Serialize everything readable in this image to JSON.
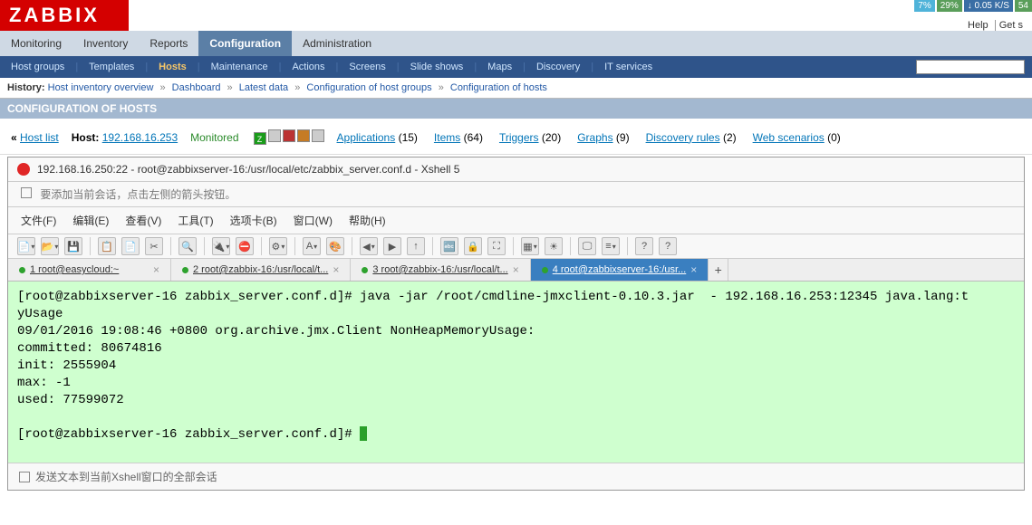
{
  "logo": "ZABBIX",
  "topstats": {
    "p1": "7%",
    "p2": "29%",
    "rate": "0.05 K/S",
    "extra": "54"
  },
  "toplinks": {
    "help": "Help",
    "get": "Get s"
  },
  "tabs1": [
    "Monitoring",
    "Inventory",
    "Reports",
    "Configuration",
    "Administration"
  ],
  "tabs1_active": 3,
  "tabs2": [
    "Host groups",
    "Templates",
    "Hosts",
    "Maintenance",
    "Actions",
    "Screens",
    "Slide shows",
    "Maps",
    "Discovery",
    "IT services"
  ],
  "tabs2_active": 2,
  "history": {
    "label": "History:",
    "items": [
      "Host inventory overview",
      "Dashboard",
      "Latest data",
      "Configuration of host groups",
      "Configuration of hosts"
    ]
  },
  "confbar": "CONFIGURATION OF HOSTS",
  "hostbar": {
    "back": "« ",
    "hostlist": "Host list",
    "hostlabel": "Host:",
    "hostip": "192.168.16.253",
    "monitored": "Monitored",
    "links": [
      {
        "label": "Applications",
        "count": "(15)"
      },
      {
        "label": "Items",
        "count": "(64)"
      },
      {
        "label": "Triggers",
        "count": "(20)"
      },
      {
        "label": "Graphs",
        "count": "(9)"
      },
      {
        "label": "Discovery rules",
        "count": "(2)"
      },
      {
        "label": "Web scenarios",
        "count": "(0)"
      }
    ]
  },
  "xshell": {
    "title": "192.168.16.250:22 - root@zabbixserver-16:/usr/local/etc/zabbix_server.conf.d - Xshell 5",
    "hint": "要添加当前会话，点击左侧的箭头按钮。",
    "menu": [
      "文件(F)",
      "编辑(E)",
      "查看(V)",
      "工具(T)",
      "选项卡(B)",
      "窗口(W)",
      "帮助(H)"
    ],
    "tabs": [
      "1 root@easycloud:~",
      "2 root@zabbix-16:/usr/local/t...",
      "3 root@zabbix-16:/usr/local/t...",
      "4 root@zabbixserver-16:/usr..."
    ],
    "tabs_active": 3,
    "terminal": "[root@zabbixserver-16 zabbix_server.conf.d]# java -jar /root/cmdline-jmxclient-0.10.3.jar  - 192.168.16.253:12345 java.lang:t\nyUsage\n09/01/2016 19:08:46 +0800 org.archive.jmx.Client NonHeapMemoryUsage:\ncommitted: 80674816\ninit: 2555904\nmax: -1\nused: 77599072\n\n[root@zabbixserver-16 zabbix_server.conf.d]# ",
    "bottom": "发送文本到当前Xshell窗口的全部会话"
  },
  "icons": {
    "new": "📄",
    "open": "📂",
    "save": "💾",
    "copy": "📋",
    "paste": "📄",
    "cut": "✂",
    "find": "🔍",
    "reconnect": "🔌",
    "disconnect": "⛔",
    "props": "⚙",
    "font": "A",
    "color": "🎨",
    "back": "◀",
    "fwd": "▶",
    "up": "↑",
    "encode": "🔤",
    "lock": "🔒",
    "fullscreen": "⛶",
    "layout": "▦",
    "trans": "☀",
    "screen": "🖵",
    "opt": "≡",
    "help": "?"
  }
}
